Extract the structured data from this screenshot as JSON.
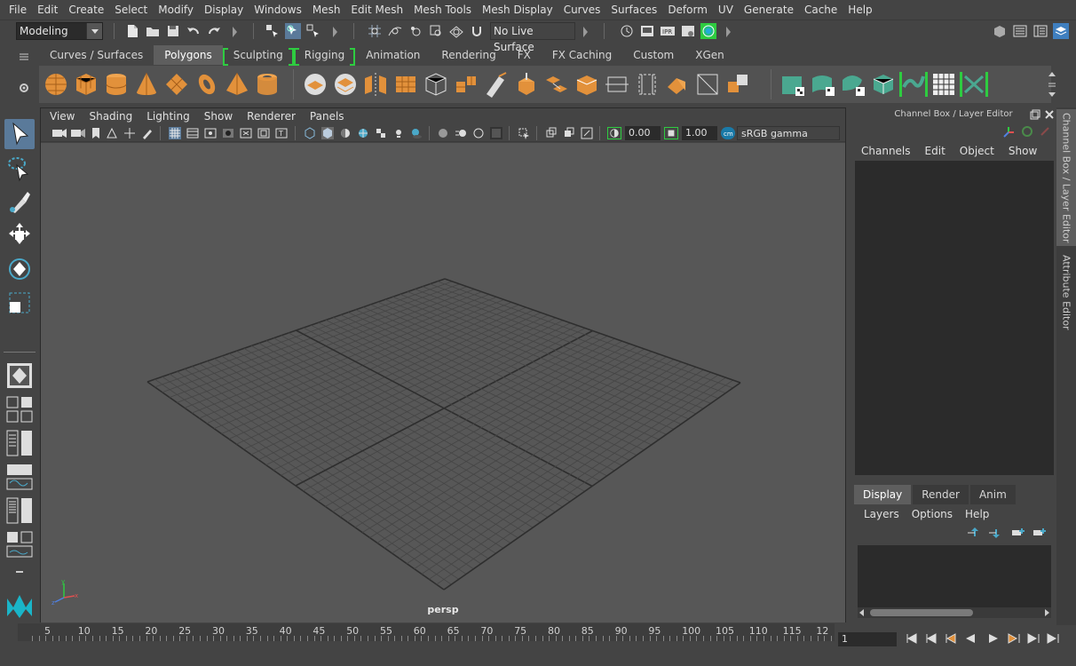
{
  "menubar": [
    "File",
    "Edit",
    "Create",
    "Select",
    "Modify",
    "Display",
    "Windows",
    "Mesh",
    "Edit Mesh",
    "Mesh Tools",
    "Mesh Display",
    "Curves",
    "Surfaces",
    "Deform",
    "UV",
    "Generate",
    "Cache",
    "Help"
  ],
  "statusline": {
    "menuset": "Modeling",
    "live_surface": "No Live Surface"
  },
  "shelf": {
    "tabs": [
      "Curves / Surfaces",
      "Polygons",
      "Sculpting",
      "Rigging",
      "Animation",
      "Rendering",
      "FX",
      "FX Caching",
      "Custom",
      "XGen"
    ],
    "active_tab": "Polygons"
  },
  "viewport": {
    "menus": [
      "View",
      "Shading",
      "Lighting",
      "Show",
      "Renderer",
      "Panels"
    ],
    "exposure": "0.00",
    "gamma": "1.00",
    "color_space": "sRGB gamma",
    "camera_label": "persp"
  },
  "timeline": {
    "ticks": [
      "5",
      "10",
      "15",
      "20",
      "25",
      "30",
      "35",
      "40",
      "45",
      "50",
      "55",
      "60",
      "65",
      "70",
      "75",
      "80",
      "85",
      "90",
      "95",
      "100",
      "105",
      "110",
      "115",
      "12"
    ],
    "current_frame": "1"
  },
  "channel_box": {
    "title": "Channel Box / Layer Editor",
    "menus": [
      "Channels",
      "Edit",
      "Object",
      "Show"
    ],
    "layer_tabs": [
      "Display",
      "Render",
      "Anim"
    ],
    "layer_menus": [
      "Layers",
      "Options",
      "Help"
    ]
  },
  "side_tabs": [
    "Channel Box / Layer Editor",
    "Attribute Editor"
  ],
  "colors": {
    "accent_green": "#2ecc40",
    "poly_orange": "#e2913b",
    "shelf_teal": "#4aa890",
    "viewport_bg": "#575757"
  }
}
